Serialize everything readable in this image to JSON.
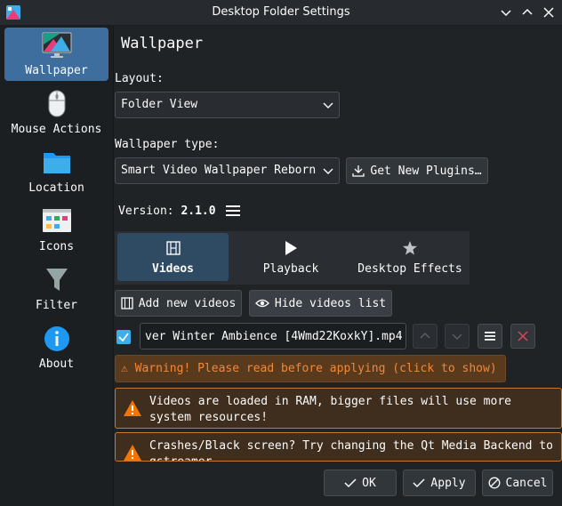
{
  "window": {
    "title": "Desktop Folder Settings"
  },
  "sidebar": {
    "items": [
      {
        "label": "Wallpaper",
        "icon": "wallpaper-icon",
        "active": true
      },
      {
        "label": "Mouse Actions",
        "icon": "mouse-icon"
      },
      {
        "label": "Location",
        "icon": "folder-icon"
      },
      {
        "label": "Icons",
        "icon": "icons-icon"
      },
      {
        "label": "Filter",
        "icon": "filter-icon"
      },
      {
        "label": "About",
        "icon": "info-icon"
      }
    ]
  },
  "main": {
    "title": "Wallpaper",
    "layout_label": "Layout:",
    "layout_value": "Folder View",
    "wallpaper_type_label": "Wallpaper type:",
    "wallpaper_type_value": "Smart Video Wallpaper Reborn",
    "get_plugins_label": "Get New Plugins…",
    "version_label": "Version:",
    "version_value": "2.1.0",
    "tabs": [
      {
        "label": "Videos",
        "icon": "film-icon",
        "active": true
      },
      {
        "label": "Playback",
        "icon": "play-icon"
      },
      {
        "label": "Desktop Effects",
        "icon": "star-icon"
      }
    ],
    "add_videos_label": "Add new videos",
    "hide_list_label": "Hide videos list",
    "video_entry": {
      "checked": true,
      "path": "ver Winter Ambience [4Wmd22KoxkY].mp4"
    },
    "warning_button": "Warning! Please read before applying (click to show)",
    "warnings": [
      "Videos are loaded in RAM, bigger files will use more system resources!",
      "Crashes/Black screen? Try changing the Qt Media Backend to gstreamer"
    ]
  },
  "footer": {
    "ok_label": "OK",
    "apply_label": "Apply",
    "cancel_label": "Cancel"
  },
  "colors": {
    "accent": "#3e6e9e",
    "warning": "#f0883a",
    "danger": "#da4453"
  }
}
